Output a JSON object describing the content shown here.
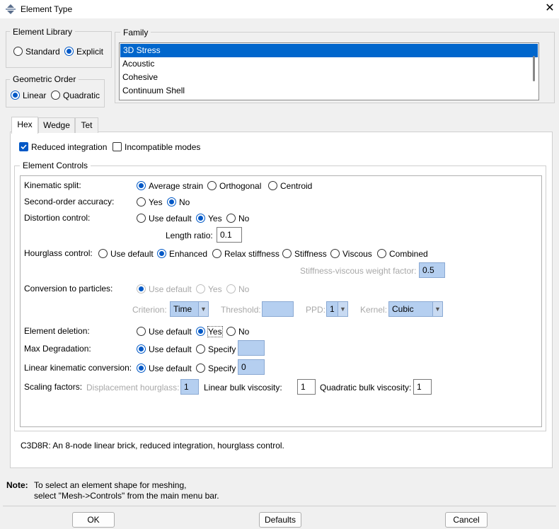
{
  "window": {
    "title": "Element Type",
    "close_glyph": "✕"
  },
  "element_library": {
    "legend": "Element Library",
    "options": [
      "Standard",
      "Explicit"
    ],
    "selected": "Explicit"
  },
  "geometric_order": {
    "legend": "Geometric Order",
    "options": [
      "Linear",
      "Quadratic"
    ],
    "selected": "Linear"
  },
  "family": {
    "legend": "Family",
    "items": [
      "3D Stress",
      "Acoustic",
      "Cohesive",
      "Continuum Shell"
    ],
    "selected": "3D Stress"
  },
  "tabs": {
    "items": [
      "Hex",
      "Wedge",
      "Tet"
    ],
    "active": "Hex"
  },
  "integration": {
    "reduced": "Reduced integration",
    "reduced_checked": true,
    "incompatible": "Incompatible modes",
    "incompatible_checked": false
  },
  "element_controls": {
    "legend": "Element Controls",
    "kinematic_split": {
      "label": "Kinematic split:",
      "options": [
        "Average strain",
        "Orthogonal",
        "Centroid"
      ],
      "selected": "Average strain"
    },
    "second_order": {
      "label": "Second-order accuracy:",
      "options": [
        "Yes",
        "No"
      ],
      "selected": "No"
    },
    "distortion": {
      "label": "Distortion control:",
      "options": [
        "Use default",
        "Yes",
        "No"
      ],
      "selected": "Yes"
    },
    "length_ratio": {
      "label": "Length ratio:",
      "value": "0.1"
    },
    "hourglass": {
      "label": "Hourglass control:",
      "options": [
        "Use default",
        "Enhanced",
        "Relax stiffness",
        "Stiffness",
        "Viscous",
        "Combined"
      ],
      "selected": "Enhanced"
    },
    "stiffness_viscous": {
      "label": "Stiffness-viscous weight factor:",
      "value": "0.5"
    },
    "conversion": {
      "label": "Conversion to particles:",
      "options": [
        "Use default",
        "Yes",
        "No"
      ],
      "selected": "Use default"
    },
    "criterion": {
      "label": "Criterion:",
      "value": "Time"
    },
    "threshold": {
      "label": "Threshold:",
      "value": ""
    },
    "ppd": {
      "label": "PPD:",
      "value": "1"
    },
    "kernel": {
      "label": "Kernel:",
      "value": "Cubic"
    },
    "element_deletion": {
      "label": "Element deletion:",
      "options": [
        "Use default",
        "Yes",
        "No"
      ],
      "selected": "Yes"
    },
    "max_degradation": {
      "label": "Max Degradation:",
      "options": [
        "Use default",
        "Specify"
      ],
      "selected": "Use default",
      "value": ""
    },
    "linear_kinematic": {
      "label": "Linear kinematic conversion:",
      "options": [
        "Use default",
        "Specify"
      ],
      "selected": "Use default",
      "value": "0"
    },
    "scaling": {
      "label": "Scaling factors:",
      "disp_label": "Displacement hourglass:",
      "disp_value": "1",
      "linear_label": "Linear bulk viscosity:",
      "linear_value": "1",
      "quad_label": "Quadratic bulk viscosity:",
      "quad_value": "1"
    }
  },
  "description": "C3D8R:  An 8-node linear brick, reduced integration, hourglass control.",
  "note": {
    "label": "Note:",
    "line1": "To select an element shape for meshing,",
    "line2": "select \"Mesh->Controls\" from the main menu bar."
  },
  "buttons": {
    "ok": "OK",
    "defaults": "Defaults",
    "cancel": "Cancel"
  },
  "colors": {
    "accent": "#0058c6",
    "selection": "#0066cc",
    "field_fill": "#b5cff0"
  }
}
